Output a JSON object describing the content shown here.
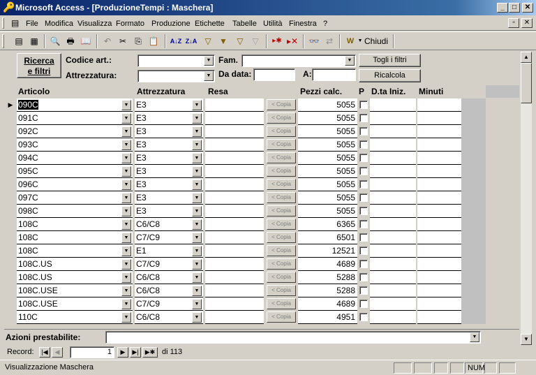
{
  "window": {
    "title": "Microsoft Access - [ProduzioneTempi : Maschera]"
  },
  "menu": [
    "File",
    "Modifica",
    "Visualizza",
    "Formato",
    "Produzione",
    "Etichette",
    "Tabelle",
    "Utilità",
    "Finestra",
    "?"
  ],
  "toolbar": {
    "close_label": "Chiudi"
  },
  "filters": {
    "search_label": "Ricerca e filtri",
    "codice_label": "Codice art.:",
    "attrezzatura_label": "Attrezzatura:",
    "fam_label": "Fam.",
    "da_data_label": "Da data:",
    "a_label": "A:",
    "remove_filters_label": "Togli i filtri",
    "recalc_label": "Ricalcola"
  },
  "columns": {
    "articolo": "Articolo",
    "attrezzatura": "Attrezzatura",
    "resa": "Resa",
    "pezzi": "Pezzi calc.",
    "p": "P",
    "dta": "D.ta Iniz.",
    "minuti": "Minuti"
  },
  "copy_label": "< Copia",
  "rows": [
    {
      "articolo": "090C",
      "attrezzatura": "E3",
      "pezzi": "5055"
    },
    {
      "articolo": "091C",
      "attrezzatura": "E3",
      "pezzi": "5055"
    },
    {
      "articolo": "092C",
      "attrezzatura": "E3",
      "pezzi": "5055"
    },
    {
      "articolo": "093C",
      "attrezzatura": "E3",
      "pezzi": "5055"
    },
    {
      "articolo": "094C",
      "attrezzatura": "E3",
      "pezzi": "5055"
    },
    {
      "articolo": "095C",
      "attrezzatura": "E3",
      "pezzi": "5055"
    },
    {
      "articolo": "096C",
      "attrezzatura": "E3",
      "pezzi": "5055"
    },
    {
      "articolo": "097C",
      "attrezzatura": "E3",
      "pezzi": "5055"
    },
    {
      "articolo": "098C",
      "attrezzatura": "E3",
      "pezzi": "5055"
    },
    {
      "articolo": "108C",
      "attrezzatura": "C6/C8",
      "pezzi": "6365"
    },
    {
      "articolo": "108C",
      "attrezzatura": "C7/C9",
      "pezzi": "6501"
    },
    {
      "articolo": "108C",
      "attrezzatura": "E1",
      "pezzi": "12521"
    },
    {
      "articolo": "108C.US",
      "attrezzatura": "C7/C9",
      "pezzi": "4689"
    },
    {
      "articolo": "108C.US",
      "attrezzatura": "C6/C8",
      "pezzi": "5288"
    },
    {
      "articolo": "108C.USE",
      "attrezzatura": "C6/C8",
      "pezzi": "5288"
    },
    {
      "articolo": "108C.USE",
      "attrezzatura": "C7/C9",
      "pezzi": "4689"
    },
    {
      "articolo": "110C",
      "attrezzatura": "C6/C8",
      "pezzi": "4951"
    }
  ],
  "actions": {
    "label": "Azioni prestabilite:"
  },
  "nav": {
    "record_label": "Record:",
    "current": "1",
    "total": "di 113"
  },
  "status": {
    "text": "Visualizzazione Maschera",
    "num": "NUM"
  }
}
